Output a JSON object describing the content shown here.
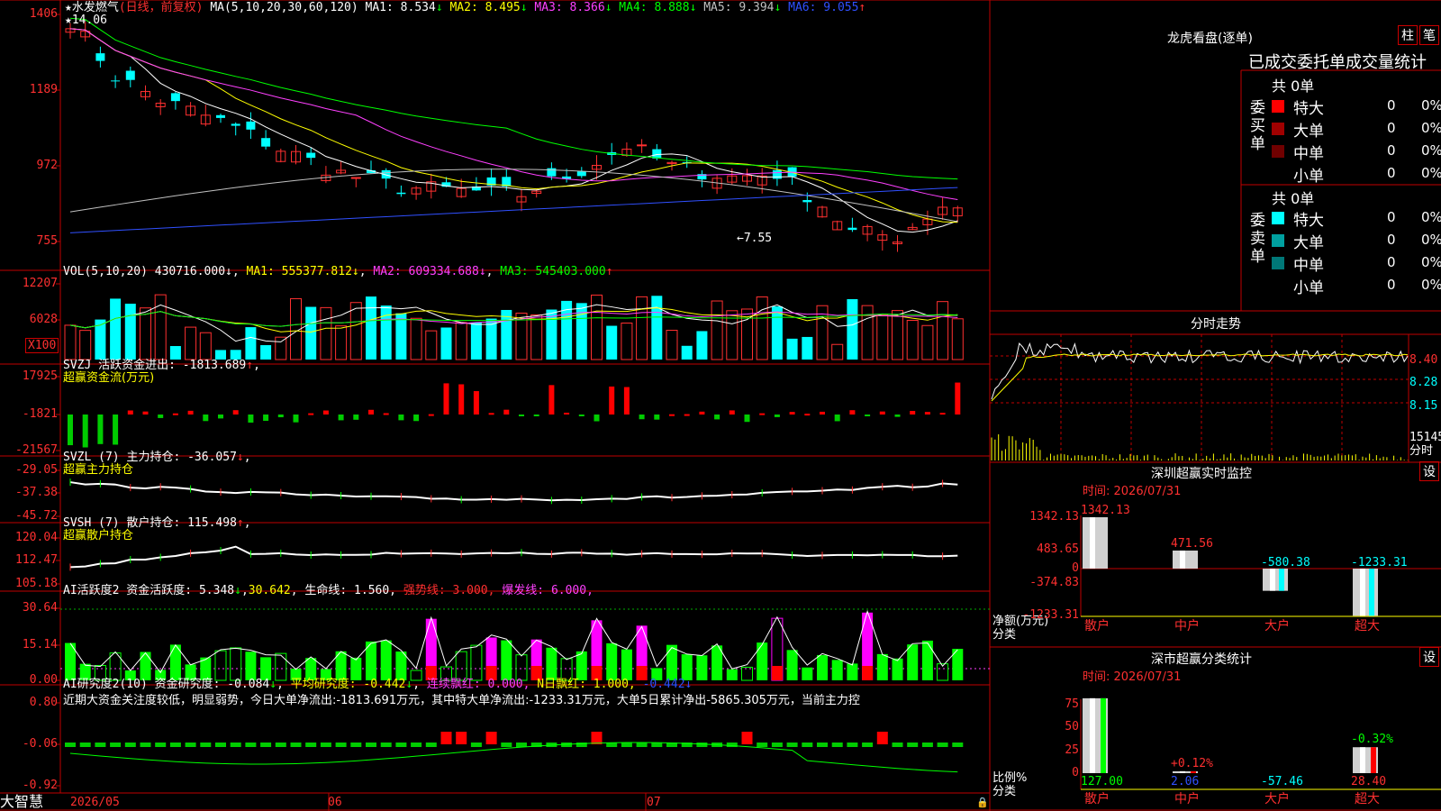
{
  "app": {
    "logo": "大智慧"
  },
  "kline": {
    "stock_prefix": "★",
    "stock_name": "水发燃气",
    "mode": "(日线，前复权)",
    "ma_label": "MA(5,10,20,30,60,120)",
    "ma_values": [
      {
        "k": "MA1:",
        "v": "8.534",
        "arrow": "↓",
        "color": "#ffffff"
      },
      {
        "k": "MA2:",
        "v": "8.495",
        "arrow": "↓",
        "color": "#ffff00"
      },
      {
        "k": "MA3:",
        "v": "8.366",
        "arrow": "↓",
        "color": "#ff40ff"
      },
      {
        "k": "MA4:",
        "v": "8.888",
        "arrow": "↓",
        "color": "#00ff00"
      },
      {
        "k": "MA5:",
        "v": "9.394",
        "arrow": "↓",
        "color": "#c0c0c0"
      },
      {
        "k": "MA6:",
        "v": "9.055",
        "arrow": "↑",
        "color": "#3050ff"
      }
    ],
    "high_label": "14.06",
    "low_label": "←7.55",
    "y_ticks": [
      "1406",
      "1189",
      "972",
      "755"
    ],
    "date_start": "2026/05",
    "month_labels": [
      "06",
      "07"
    ]
  },
  "vol": {
    "label": "VOL(5,10,20)",
    "value": "430716.000",
    "value_arrow": "↓",
    "ma1": "MA1: 555377.812",
    "ma1_arrow": "↓",
    "ma2": "MA2: 609334.688",
    "ma2_arrow": "↓",
    "ma3": "MA3: 545403.000",
    "ma3_arrow": "↑",
    "y_ticks": [
      "12207",
      "6028"
    ],
    "unit": "X100"
  },
  "svzj": {
    "label": "SVZJ  活跃资金进出:",
    "value": "-1813.689",
    "arrow": "↑",
    "tail": ",",
    "subtitle": "超赢资金流(万元)",
    "y_ticks": [
      "17925",
      "-1821",
      "-21567"
    ]
  },
  "svzl": {
    "label": "SVZL (7) 主力持仓:",
    "value": "-36.057",
    "arrow": "↓",
    "tail": ",",
    "subtitle": "超赢主力持仓",
    "y_ticks": [
      "-29.05",
      "-37.38",
      "-45.72"
    ]
  },
  "svsh": {
    "label": "SVSH (7) 散户持仓:",
    "value": "115.498",
    "arrow": "↑",
    "tail": ",",
    "subtitle": "超赢散户持仓",
    "y_ticks": [
      "120.04",
      "112.47",
      "105.18"
    ]
  },
  "ai1": {
    "label": "AI活跃度2 资金活跃度:",
    "v1": "5.348",
    "v1_arrow": "↓",
    "v2": "30.642",
    "life": "生命线: 1.560,",
    "strong": "强势线: 3.000,",
    "burst": "爆发线: 6.000,",
    "y_ticks": [
      "30.64",
      "15.14",
      "0.00"
    ]
  },
  "ai2": {
    "label": "AI研究度2(10) 资金研究度:",
    "v1": "-0.084",
    "v1_arrow": "↓",
    "avg": "平均研究度: -0.442",
    "avg_arrow": "↓",
    "lianxu": "连续飘红: 0.000,",
    "nday": "N日飘红: 1.000,",
    "last": "-0.442",
    "last_arrow": "↓",
    "comment": "近期大资金关注度较低，明显弱势，今日大单净流出:-1813.691万元，其中特大单净流出:-1233.31万元，大单5日累计净出-5865.305万元，当前主力控",
    "y_ticks": [
      "0.80",
      "-0.06",
      "-0.92"
    ]
  },
  "right": {
    "lhb_title": "龙虎看盘(逐单)",
    "btn_bar": "柱",
    "btn_pen": "笔",
    "tabs_text": "已成交委托单成交量统计",
    "buy_group": "委买单",
    "sell_group": "委卖单",
    "buy_total": "共 0单",
    "sell_total": "共 0单",
    "buy_rows": [
      {
        "name": "特大",
        "count": "0",
        "pct": "0%",
        "color": "#ff0000"
      },
      {
        "name": "大单",
        "count": "0",
        "pct": "0%",
        "color": "#a00000"
      },
      {
        "name": "中单",
        "count": "0",
        "pct": "0%",
        "color": "#700000"
      },
      {
        "name": "小单",
        "count": "0",
        "pct": "0%",
        "color": ""
      }
    ],
    "sell_rows": [
      {
        "name": "特大",
        "count": "0",
        "pct": "0%",
        "color": "#00ffff"
      },
      {
        "name": "大单",
        "count": "0",
        "pct": "0%",
        "color": "#00a0a0"
      },
      {
        "name": "中单",
        "count": "0",
        "pct": "0%",
        "color": "#007878"
      },
      {
        "name": "小单",
        "count": "0",
        "pct": "0%",
        "color": ""
      }
    ],
    "fs_title": "分时走势",
    "fs_prices": [
      "8.40",
      "8.28",
      "8.15"
    ],
    "fs_vol_top": "15145",
    "fs_vol_label": "分时",
    "sz_title": "深圳超赢实时监控",
    "sz_time": "时间: 2026/07/31",
    "sz_btn": "设",
    "sz_y": [
      "1342.13",
      "483.65",
      "0",
      "-374.83",
      "-1233.31"
    ],
    "sz_ylabel1": "净额(万元)",
    "sz_ylabel2": "分类",
    "sz_bars": [
      {
        "cat": "散户",
        "value": 1342.13,
        "label": "1342.13",
        "color": "#ff3030"
      },
      {
        "cat": "中户",
        "value": 471.56,
        "label": "471.56",
        "color": "#ff3030"
      },
      {
        "cat": "大户",
        "value": -580.38,
        "label": "-580.38",
        "color": "#00ffff"
      },
      {
        "cat": "超大",
        "value": -1233.31,
        "label": "-1233.31",
        "color": "#00ffff"
      }
    ],
    "sc_title": "深市超赢分类统计",
    "sc_time": "时间: 2026/07/31",
    "sc_btn": "设",
    "sc_y": [
      "75",
      "50",
      "25",
      "0"
    ],
    "sc_ylabel1": "比例%",
    "sc_ylabel2": "分类",
    "sc_bars": [
      {
        "cat": "散户",
        "value": 127.0,
        "label": "127.00",
        "pct": "",
        "pct_color": ""
      },
      {
        "cat": "中户",
        "value": 2.06,
        "label": "2.06",
        "pct": "+0.12%",
        "pct_color": "#ff3030"
      },
      {
        "cat": "大户",
        "value": -57.46,
        "label": "-57.46",
        "pct": "",
        "pct_color": ""
      },
      {
        "cat": "超大",
        "value": 28.4,
        "label": "28.40",
        "pct": "-0.32%",
        "pct_color": "#00ff00"
      }
    ]
  }
}
